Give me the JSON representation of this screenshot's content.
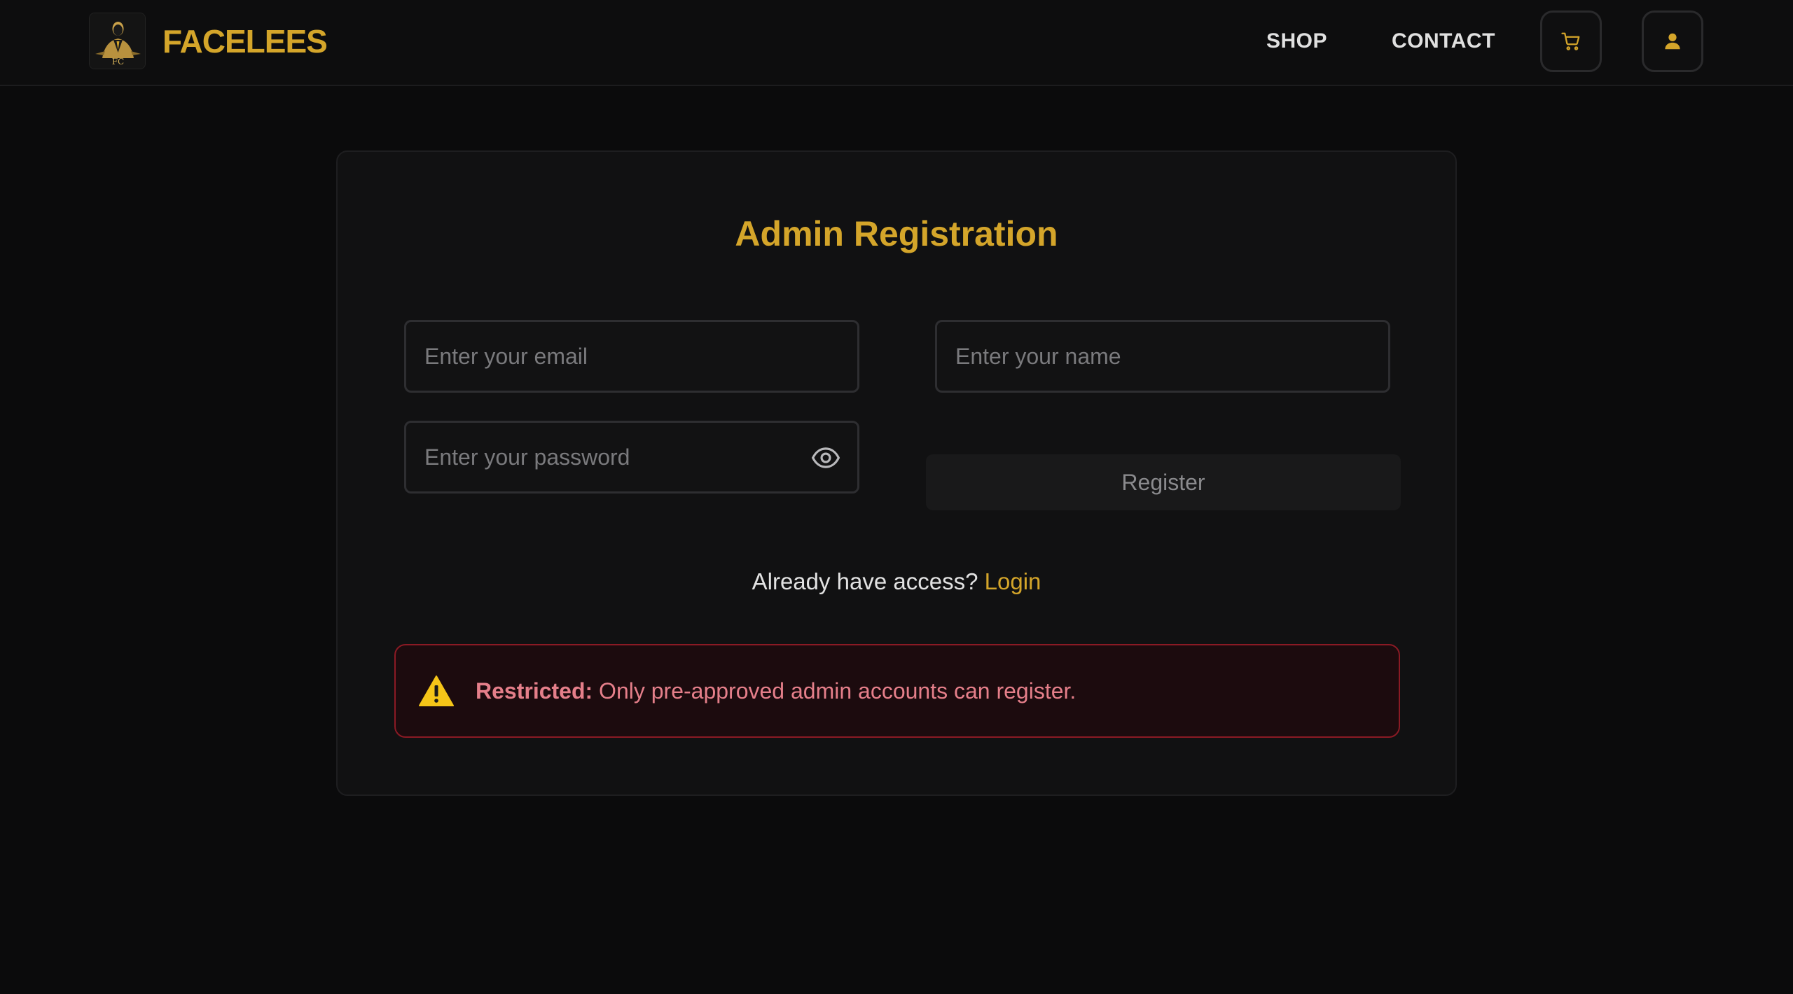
{
  "header": {
    "brand_name": "FACELEES",
    "logo_text": "FC",
    "nav": [
      {
        "label": "SHOP"
      },
      {
        "label": "CONTACT"
      }
    ],
    "accent_color": "#d4a52a"
  },
  "form": {
    "title": "Admin Registration",
    "email_placeholder": "Enter your email",
    "name_placeholder": "Enter your name",
    "password_placeholder": "Enter your password",
    "email_value": "",
    "name_value": "",
    "password_value": "",
    "register_label": "Register",
    "access_prompt": "Already have access?",
    "login_label": "Login"
  },
  "alert": {
    "label": "Restricted:",
    "message": " Only pre-approved admin accounts can register.",
    "icon": "warning-icon",
    "color": "#e57f8a"
  }
}
